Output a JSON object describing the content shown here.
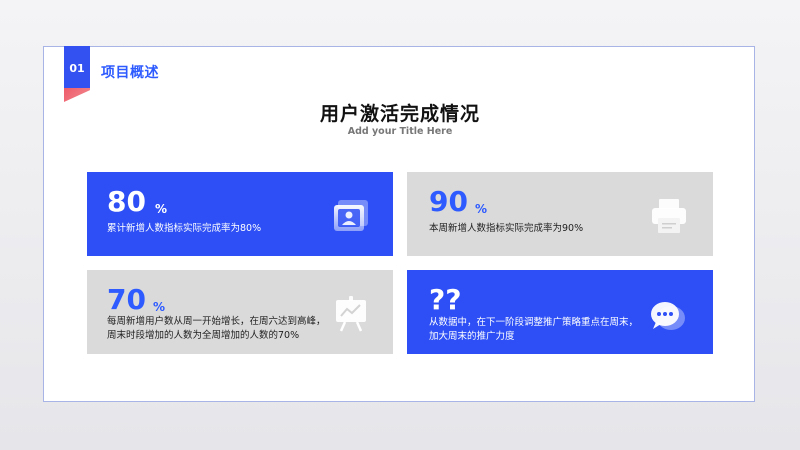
{
  "header": {
    "section_number": "01",
    "section_title": "项目概述"
  },
  "title": {
    "main": "用户激活完成情况",
    "subtitle": "Add your Title Here"
  },
  "cards": [
    {
      "value": "80",
      "unit": "%",
      "description": "累计新增人数指标实际完成率为80%",
      "icon": "id-card-icon",
      "style": "blue"
    },
    {
      "value": "90",
      "unit": "%",
      "description": "本周新增人数指标实际完成率为90%",
      "icon": "printer-icon",
      "style": "gray"
    },
    {
      "value": "70",
      "unit": "%",
      "description_lines": [
        "每周新增用户数从周一开始增长，在周六达到高峰，",
        "周末时段增加的人数为全周增加的人数的70%"
      ],
      "icon": "chart-board-icon",
      "style": "gray"
    },
    {
      "value": "??",
      "description_lines": [
        "从数据中，在下一阶段调整推广策略重点在周末，",
        "加大周末的推广力度"
      ],
      "icon": "chat-bubble-icon",
      "style": "blue"
    }
  ],
  "colors": {
    "accent_blue": "#2d4ff5",
    "title_blue": "#2e5bff",
    "card_gray": "#dadada",
    "tab_pink": "#ef5b6a"
  }
}
